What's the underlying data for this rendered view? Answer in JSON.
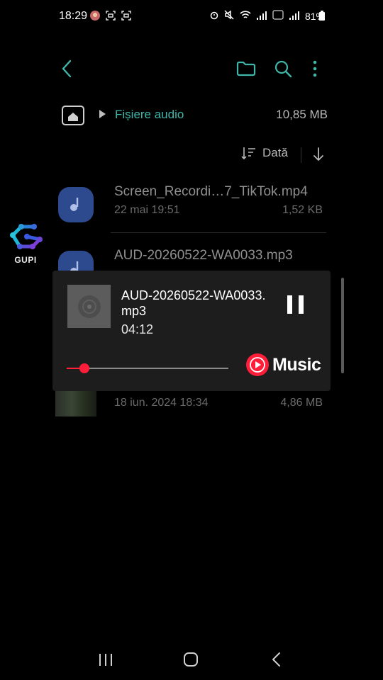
{
  "status_bar": {
    "time": "18:29",
    "battery": "81%"
  },
  "toolbar": {
    "back_icon": "chevron-left-icon",
    "folder_icon": "folder-icon",
    "search_icon": "search-icon",
    "more_icon": "more-vert-icon"
  },
  "path": {
    "label": "Fișiere audio",
    "size": "10,85 MB"
  },
  "sort": {
    "label": "Dată"
  },
  "files": [
    {
      "name": "Screen_Recordi…7_TikTok.mp4",
      "date": "22 mai 19:51",
      "size": "1,52 KB"
    },
    {
      "name": "AUD-20260522-WA0033.mp3",
      "date": "",
      "size": ""
    },
    {
      "name": "",
      "date": "18 iun. 2024 18:34",
      "size": "4,86 MB"
    }
  ],
  "side_logo": {
    "label": "GUPI"
  },
  "player": {
    "title": "AUD-20260522-WA0033.mp3",
    "time": "04:12",
    "progress": 0.11,
    "brand_label": "Music",
    "accent": "#ff1e3a"
  },
  "colors": {
    "accent_teal": "#3fb6a8",
    "file_icon_bg": "#2d4a8e"
  }
}
